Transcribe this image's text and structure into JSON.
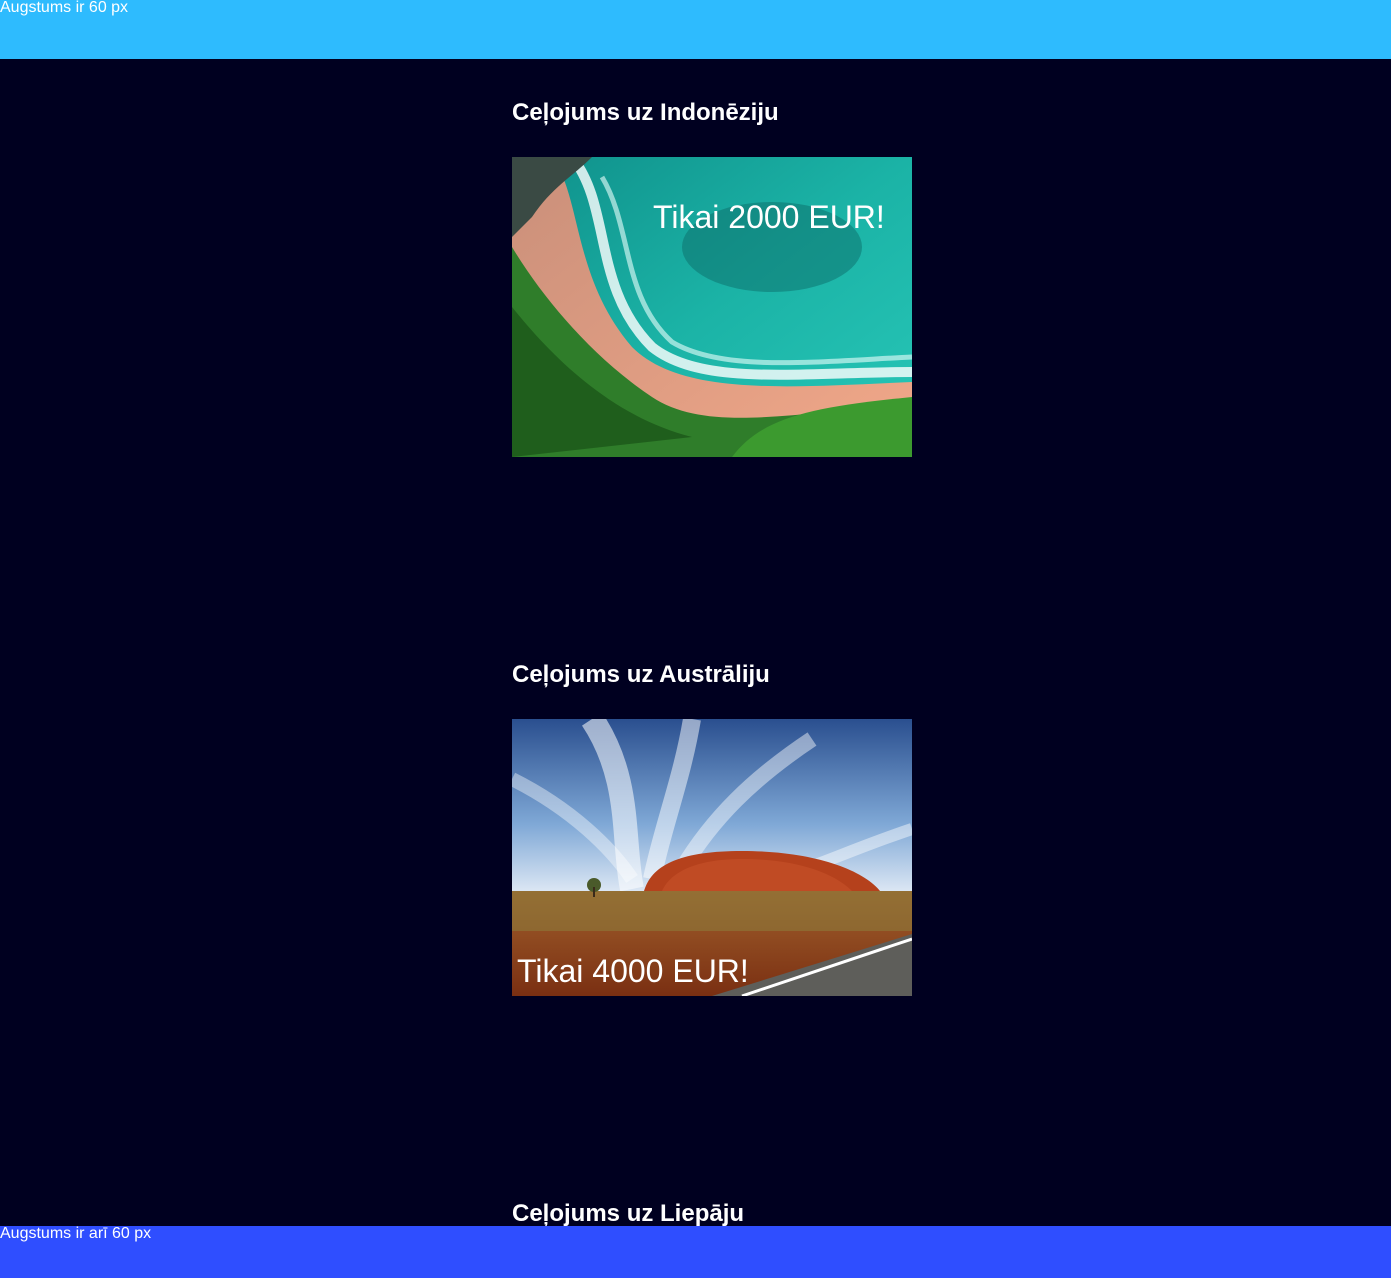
{
  "header": {
    "text": "Augstums ir 60 px",
    "color": "#2EBBFE"
  },
  "trips": [
    {
      "title": "Ceļojums uz Indonēziju",
      "price": "Tikai 2000 EUR!",
      "image": "tropical-beach-photo"
    },
    {
      "title": "Ceļojums uz Austrāliju",
      "price": "Tikai 4000 EUR!",
      "image": "uluru-desert-photo"
    },
    {
      "title": "Ceļojums uz Liepāju"
    }
  ],
  "footer": {
    "text": "Augstums ir arī 60 px",
    "color": "#2F4EFF"
  },
  "page_background": "#000020"
}
